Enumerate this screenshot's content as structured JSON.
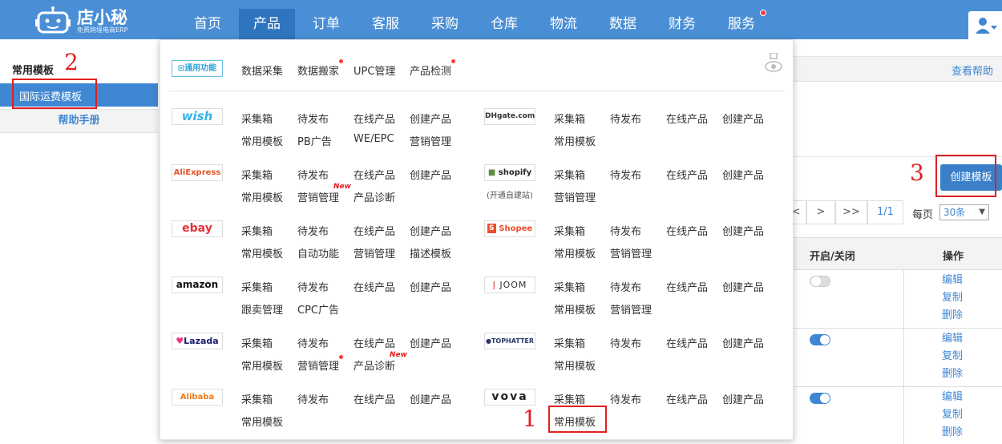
{
  "brand": {
    "name": "店小秘",
    "slogan": "免费跨境电商ERP"
  },
  "nav": {
    "items": [
      {
        "label": "首页",
        "active": false
      },
      {
        "label": "产品",
        "active": true
      },
      {
        "label": "订单",
        "active": false
      },
      {
        "label": "客服",
        "active": false
      },
      {
        "label": "采购",
        "active": false
      },
      {
        "label": "仓库",
        "active": false
      },
      {
        "label": "物流",
        "active": false
      },
      {
        "label": "数据",
        "active": false
      },
      {
        "label": "财务",
        "active": false
      },
      {
        "label": "服务",
        "active": false,
        "dot": true
      }
    ]
  },
  "sidebar": {
    "title": "常用模板",
    "active_item": "国际运费模板",
    "help": "帮助手册"
  },
  "dropdown": {
    "general": {
      "badge": "通用功能",
      "links": [
        "数据采集",
        "数据搬家",
        "UPC管理",
        "产品检测"
      ]
    },
    "platforms": [
      {
        "logo": "wish",
        "color": "#2fb7ec",
        "row1": [
          "采集箱",
          "待发布",
          "在线产品",
          "创建产品"
        ],
        "row2": [
          "常用模板",
          "PB广告",
          "WE/EPC",
          "营销管理"
        ]
      },
      {
        "logo": "AliExpress",
        "color": "#e8552a",
        "row1": [
          "采集箱",
          "待发布",
          "在线产品",
          "创建产品"
        ],
        "row2": [
          "常用模板",
          "营销管理",
          "产品诊断"
        ]
      },
      {
        "logo": "ebay",
        "color": "#e53238",
        "row1": [
          "采集箱",
          "待发布",
          "在线产品",
          "创建产品"
        ],
        "row2": [
          "常用模板",
          "自动功能",
          "营销管理",
          "描述模板"
        ]
      },
      {
        "logo": "amazon",
        "color": "#111111",
        "row1": [
          "采集箱",
          "待发布",
          "在线产品",
          "创建产品"
        ],
        "row2": [
          "跟卖管理",
          "CPC广告"
        ]
      },
      {
        "logo": "Lazada",
        "color": "#1a1a6e",
        "row1": [
          "采集箱",
          "待发布",
          "在线产品",
          "创建产品"
        ],
        "row2": [
          "常用模板",
          "营销管理",
          "产品诊断"
        ]
      },
      {
        "logo": "Alibaba",
        "color": "#f07b1d",
        "row1": [
          "采集箱",
          "待发布",
          "在线产品",
          "创建产品"
        ],
        "row2": [
          "常用模板"
        ]
      },
      {
        "logo": "DHgate.com",
        "color": "#333333",
        "row1": [
          "采集箱",
          "待发布",
          "在线产品",
          "创建产品"
        ],
        "row2": [
          "常用模板"
        ]
      },
      {
        "logo": "shopify",
        "sub": "(开通自建站)",
        "color": "#5e8e3e",
        "row1": [
          "采集箱",
          "待发布",
          "在线产品",
          "创建产品"
        ],
        "row2": [
          "营销管理"
        ]
      },
      {
        "logo": "Shopee",
        "color": "#ee4d2d",
        "row1": [
          "采集箱",
          "待发布",
          "在线产品",
          "创建产品"
        ],
        "row2": [
          "常用模板",
          "营销管理"
        ]
      },
      {
        "logo": "JOOM",
        "color": "#333333",
        "row1": [
          "采集箱",
          "待发布",
          "在线产品",
          "创建产品"
        ],
        "row2": [
          "常用模板",
          "营销管理"
        ]
      },
      {
        "logo": "TOPHATTER",
        "color": "#2b3a6b",
        "row1": [
          "采集箱",
          "待发布",
          "在线产品",
          "创建产品"
        ],
        "row2": [
          "常用模板"
        ]
      },
      {
        "logo": "vova",
        "color": "#222222",
        "row1": [
          "采集箱",
          "待发布",
          "在线产品",
          "创建产品"
        ],
        "row2": [
          "常用模板"
        ]
      }
    ],
    "new_badge": "New"
  },
  "right_panel": {
    "help_link": "查看帮助",
    "create_button": "创建模板",
    "pager": {
      "first": "<",
      "next": ">",
      "last": ">>",
      "page": "1/1",
      "per_page_label": "每页",
      "per_page_value": "30条"
    },
    "table_headers": {
      "toggle": "开启/关闭",
      "ops": "操作"
    },
    "rows": [
      {
        "enabled": false,
        "actions": [
          "编辑",
          "复制",
          "删除"
        ]
      },
      {
        "enabled": true,
        "actions": [
          "编辑",
          "复制",
          "删除"
        ]
      },
      {
        "enabled": true,
        "actions": [
          "编辑",
          "复制",
          "删除"
        ]
      }
    ]
  },
  "annotations": {
    "a1": "1",
    "a2": "2",
    "a3": "3"
  },
  "colors": {
    "accent": "#4a8fd6",
    "highlight": "#e02020"
  }
}
